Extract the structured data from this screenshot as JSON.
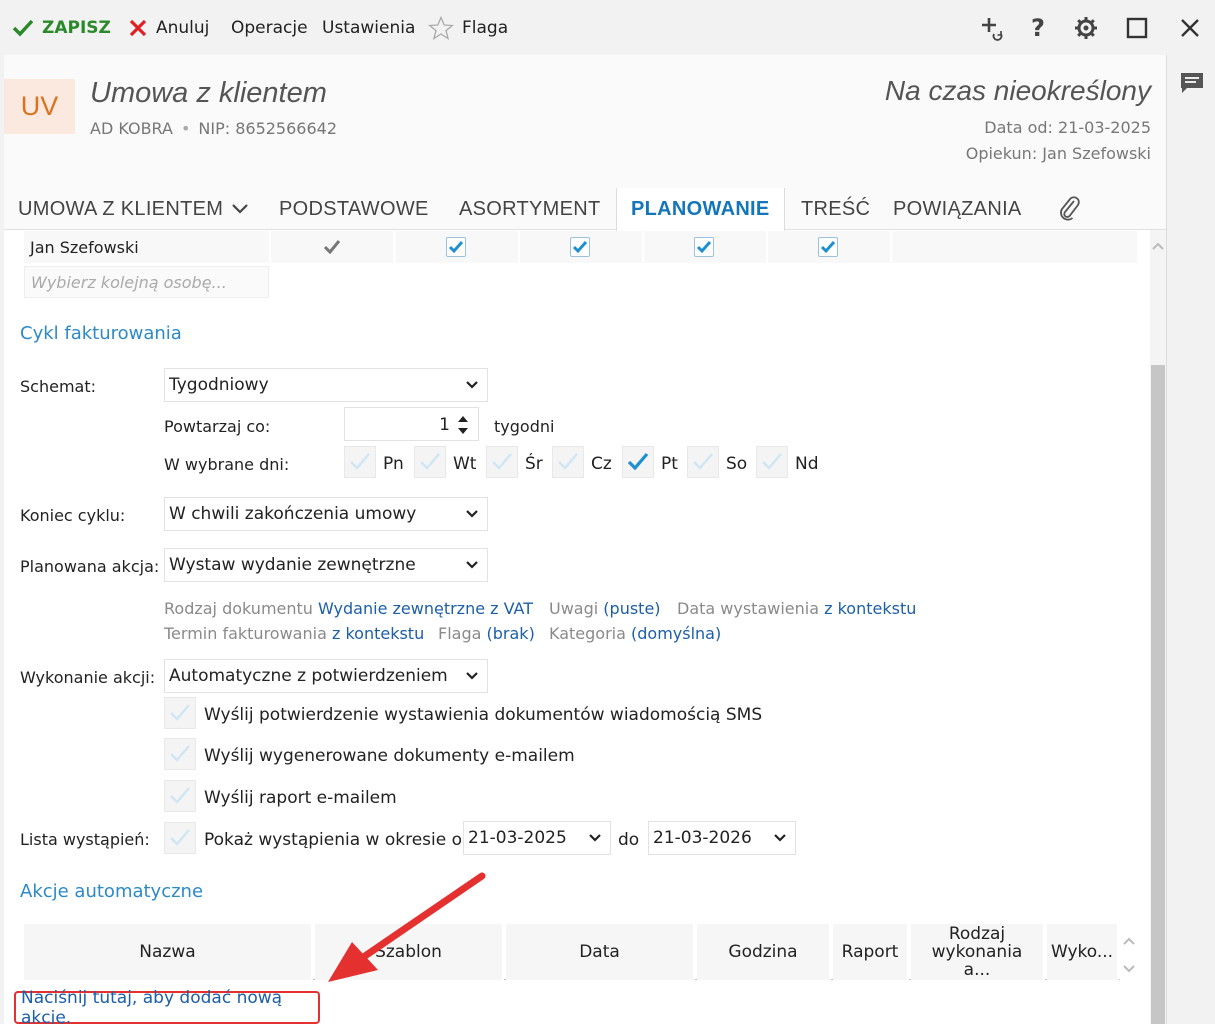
{
  "toolbar": {
    "save": "ZAPISZ",
    "cancel": "Anuluj",
    "operations": "Operacje",
    "settings": "Ustawienia",
    "flag": "Flaga"
  },
  "header": {
    "badge": "UV",
    "title": "Umowa z klientem",
    "company": "AD KOBRA",
    "nip": "NIP: 8652566642",
    "period": "Na czas nieokreślony",
    "date_from": "Data od: 21-03-2025",
    "guardian": "Opiekun: Jan Szefowski"
  },
  "tabs": [
    {
      "label": "UMOWA Z KLIENTEM"
    },
    {
      "label": "PODSTAWOWE"
    },
    {
      "label": "ASORTYMENT"
    },
    {
      "label": "PLANOWANIE",
      "active": true
    },
    {
      "label": "TREŚĆ"
    },
    {
      "label": "POWIĄZANIA"
    }
  ],
  "persons": {
    "name": "Jan Szefowski",
    "placeholder": "Wybierz kolejną osobę..."
  },
  "billing": {
    "section": "Cykl fakturowania",
    "schema_label": "Schemat:",
    "schema_value": "Tygodniowy",
    "repeat_label": "Powtarzaj co:",
    "repeat_value": "1",
    "repeat_unit": "tygodni",
    "days_label": "W wybrane dni:",
    "days": [
      {
        "label": "Pn",
        "checked": false
      },
      {
        "label": "Wt",
        "checked": false
      },
      {
        "label": "Śr",
        "checked": false
      },
      {
        "label": "Cz",
        "checked": false
      },
      {
        "label": "Pt",
        "checked": true
      },
      {
        "label": "So",
        "checked": false
      },
      {
        "label": "Nd",
        "checked": false
      }
    ],
    "end_label": "Koniec cyklu:",
    "end_value": "W chwili zakończenia umowy",
    "action_label": "Planowana akcja:",
    "action_value": "Wystaw wydanie zewnętrzne",
    "info": {
      "doc_type_label": "Rodzaj dokumentu",
      "doc_type_value": "Wydanie zewnętrzne z VAT",
      "notes_label": "Uwagi",
      "notes_value": "(puste)",
      "issue_date_label": "Data wystawienia",
      "issue_date_value": "z kontekstu",
      "billing_term_label": "Termin fakturowania",
      "billing_term_value": "z kontekstu",
      "flag_label": "Flaga",
      "flag_value": "(brak)",
      "category_label": "Kategoria",
      "category_value": "(domyślna)"
    },
    "exec_label": "Wykonanie akcji:",
    "exec_value": "Automatyczne z potwierdzeniem",
    "opt_sms": "Wyślij potwierdzenie wystawienia dokumentów wiadomością SMS",
    "opt_email_docs": "Wyślij wygenerowane dokumenty e-mailem",
    "opt_email_report": "Wyślij raport e-mailem",
    "list_label": "Lista wystąpień:",
    "list_option": "Pokaż wystąpienia w okresie od",
    "list_from": "21-03-2025",
    "list_to_label": "do",
    "list_to": "21-03-2026"
  },
  "auto_actions": {
    "section": "Akcje automatyczne",
    "columns": [
      "Nazwa",
      "Szablon",
      "Data",
      "Godzina",
      "Raport",
      "Rodzaj wykonania a...",
      "Wyko..."
    ],
    "add_link": "Naciśnij tutaj, aby dodać nową akcję."
  },
  "colors": {
    "accent": "#1476ba",
    "save_green": "#2a8a2a",
    "cancel_red": "#e02020",
    "badge_bg": "#fbe9df",
    "badge_fg": "#d9731e",
    "annotation_red": "#e53030"
  }
}
